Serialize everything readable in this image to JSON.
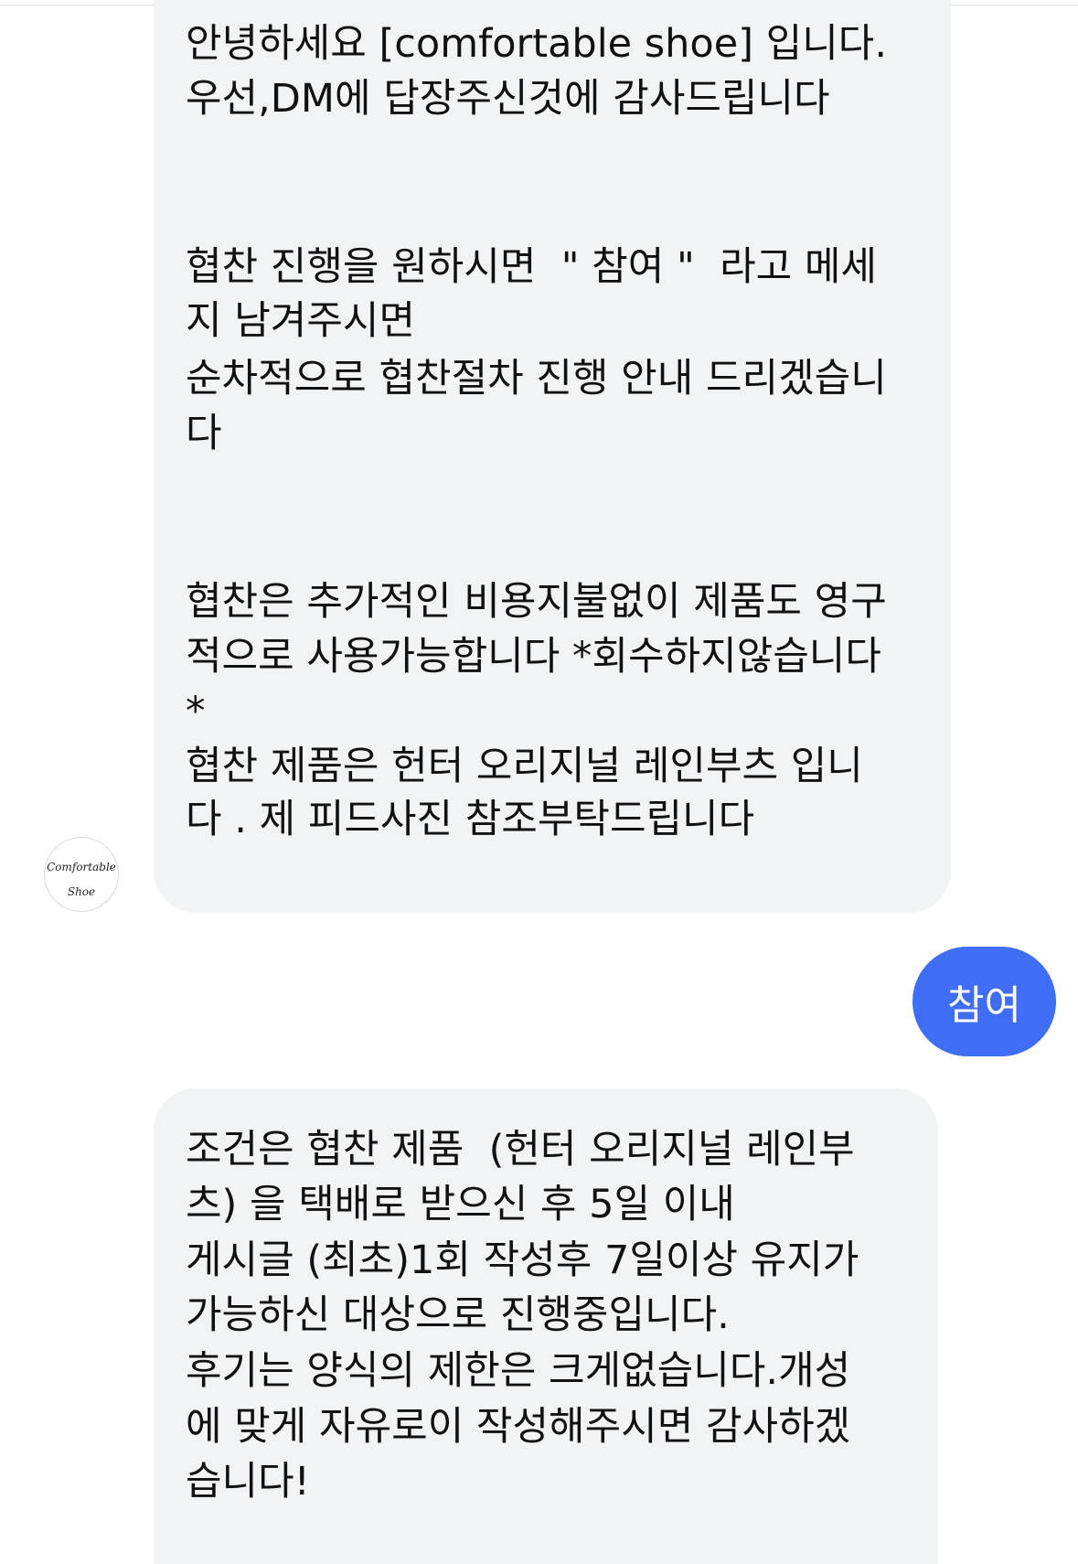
{
  "conversation": {
    "received_message_1": {
      "lines": [
        "안녕하세요 [comfortable shoe] 입니다.",
        "우선,DM에 답장주신것에 감사드립니다",
        "협찬 진행을 원하시면  \" 참여 \"  라고 메세",
        "지 남겨주시면",
        "순차적으로 협찬절차 진행 안내 드리겠습니",
        "다",
        "협찬은 추가적인 비용지불없이 제품도 영구",
        "적으로 사용가능합니다 *회수하지않습니다",
        "*",
        "협찬 제품은 헌터 오리지널 레인부츠 입니",
        "다 . 제 피드사진 참조부탁드립니다"
      ]
    },
    "sender_avatar": {
      "logo_text_line1": "Comfortable",
      "logo_text_line2": "Shoe"
    },
    "sent_message": {
      "text": "참여"
    },
    "received_message_2": {
      "lines": [
        "조건은 협찬 제품  (헌터 오리지널 레인부",
        "츠) 을 택배로 받으신 후 5일 이내",
        "게시글 (최초)1회 작성후 7일이상 유지가",
        "가능하신 대상으로 진행중입니다.",
        "후기는 양식의 제한은 크게없습니다.개성",
        "에 맞게 자유로이 작성해주시면 감사하겠",
        "습니다!"
      ]
    }
  },
  "colors": {
    "received_bubble": "#f2f3f5",
    "sent_bubble": "#3f6ef5",
    "text_dark": "#111111",
    "text_light": "#ffffff"
  }
}
